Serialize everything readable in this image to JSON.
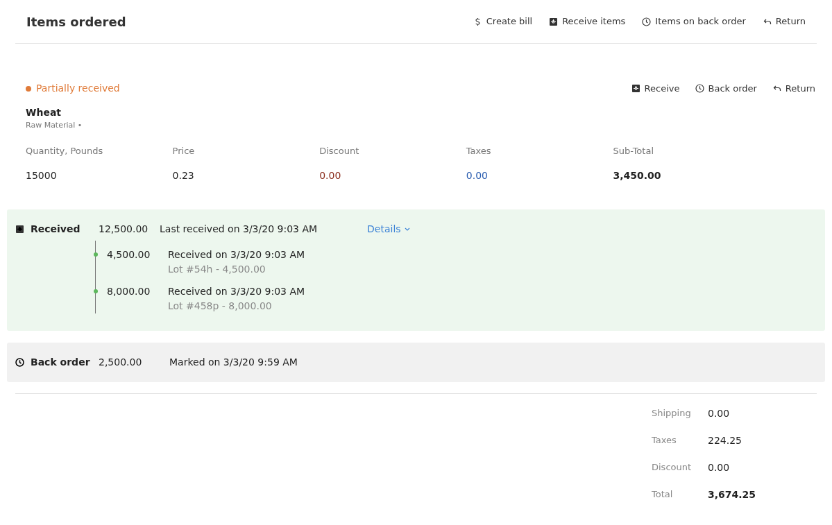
{
  "header": {
    "title": "Items ordered",
    "actions": [
      {
        "kind": "dollar",
        "label": "Create bill"
      },
      {
        "kind": "receive",
        "label": "Receive items"
      },
      {
        "kind": "clock",
        "label": "Items on back order"
      },
      {
        "kind": "return",
        "label": "Return"
      }
    ]
  },
  "item": {
    "status": {
      "label": "Partially received",
      "color": "#e07b39"
    },
    "actions": [
      {
        "kind": "receive",
        "label": "Receive"
      },
      {
        "kind": "clock",
        "label": "Back order"
      },
      {
        "kind": "return",
        "label": "Return"
      }
    ],
    "name": "Wheat",
    "category": "Raw Material •",
    "fields": [
      {
        "label": "Quantity, Pounds",
        "value": "15000",
        "kind": "plain"
      },
      {
        "label": "Price",
        "value": "0.23",
        "kind": "plain"
      },
      {
        "label": "Discount",
        "value": "0.00",
        "kind": "negative"
      },
      {
        "label": "Taxes",
        "value": "0.00",
        "kind": "link"
      },
      {
        "label": "Sub-Total",
        "value": "3,450.00",
        "kind": "bold"
      }
    ]
  },
  "received": {
    "label": "Received",
    "amount": "12,500.00",
    "note": "Last received on 3/3/20 9:03 AM",
    "details": "Details",
    "expanded": true,
    "entries": [
      {
        "amount": "4,500.00",
        "note": "Received on 3/3/20 9:03 AM",
        "lot": "Lot #54h - 4,500.00"
      },
      {
        "amount": "8,000.00",
        "note": "Received on 3/3/20 9:03 AM",
        "lot": "Lot #458p - 8,000.00"
      }
    ]
  },
  "back_order": {
    "label": "Back order",
    "amount": "2,500.00",
    "note": "Marked on 3/3/20 9:59 AM"
  },
  "totals": [
    {
      "label": "Shipping",
      "value": "0.00",
      "kind": "plain"
    },
    {
      "label": "Taxes",
      "value": "224.25",
      "kind": "plain"
    },
    {
      "label": "Discount",
      "value": "0.00",
      "kind": "plain"
    },
    {
      "label": "Total",
      "value": "3,674.25",
      "kind": "bold"
    }
  ]
}
